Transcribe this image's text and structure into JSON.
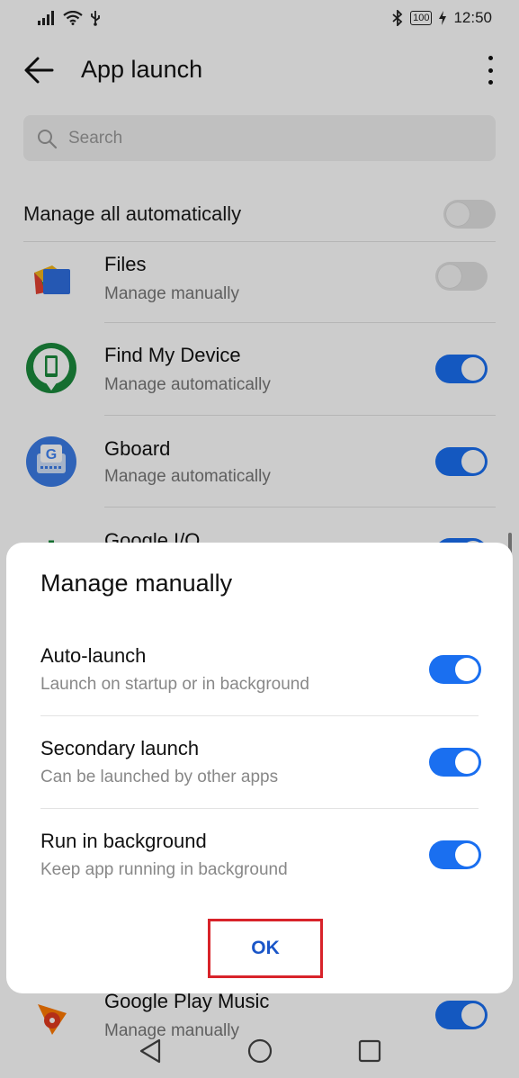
{
  "status_bar": {
    "battery": "100",
    "time": "12:50"
  },
  "app_bar": {
    "title": "App launch"
  },
  "search": {
    "placeholder": "Search"
  },
  "manage_all": {
    "label": "Manage all automatically",
    "enabled": false
  },
  "apps": [
    {
      "name": "Files",
      "status": "Manage manually",
      "enabled": false,
      "icon": "files-icon"
    },
    {
      "name": "Find My Device",
      "status": "Manage automatically",
      "enabled": true,
      "icon": "find-my-device-icon"
    },
    {
      "name": "Gboard",
      "status": "Manage automatically",
      "enabled": true,
      "icon": "gboard-icon"
    },
    {
      "name": "Google I/O",
      "status": "",
      "enabled": true,
      "icon": "google-io-icon"
    },
    {
      "name": "Google Play Music",
      "status": "Manage manually",
      "enabled": true,
      "icon": "play-music-icon"
    }
  ],
  "dialog": {
    "title": "Manage manually",
    "options": [
      {
        "name": "Auto-launch",
        "desc": "Launch on startup or in background",
        "enabled": true
      },
      {
        "name": "Secondary launch",
        "desc": "Can be launched by other apps",
        "enabled": true
      },
      {
        "name": "Run in background",
        "desc": "Keep app running in background",
        "enabled": true
      }
    ],
    "ok_label": "OK"
  },
  "colors": {
    "accent": "#1a6ff0",
    "ok_text": "#1a56c8",
    "highlight_border": "#d8232a"
  }
}
